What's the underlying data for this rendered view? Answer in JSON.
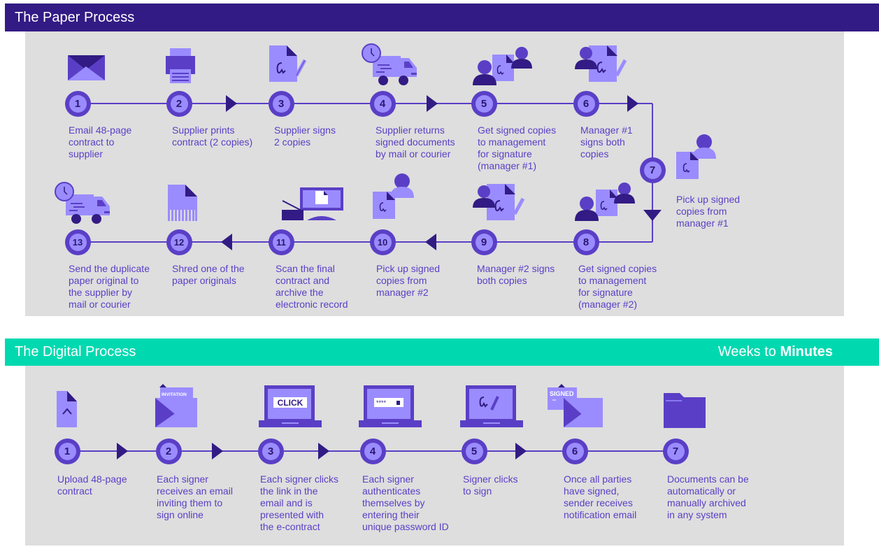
{
  "colors": {
    "paper_header": "#321b84",
    "digital_header": "#00d9b0",
    "panel": "#dedede",
    "accent": "#5a3fc6",
    "accent_light": "#9a8cff",
    "accent_dark": "#321b84"
  },
  "paper": {
    "title": "The Paper Process",
    "steps": [
      {
        "num": "1",
        "icon": "envelope-icon",
        "text": "Email 48-page\ncontract to\nsupplier"
      },
      {
        "num": "2",
        "icon": "printer-icon",
        "text": "Supplier prints\ncontract (2 copies)"
      },
      {
        "num": "3",
        "icon": "signed-document-pen-icon",
        "text": "Supplier signs\n2 copies"
      },
      {
        "num": "4",
        "icon": "delivery-truck-clock-icon",
        "text": "Supplier returns\nsigned documents\nby mail or courier"
      },
      {
        "num": "5",
        "icon": "people-document-icon",
        "text": "Get signed copies\nto management\nfor signature\n(manager #1)"
      },
      {
        "num": "6",
        "icon": "person-signing-document-icon",
        "text": "Manager #1\nsigns both\ncopies"
      },
      {
        "num": "7",
        "icon": "document-person-icon",
        "text": "Pick up signed\ncopies from\nmanager #1"
      },
      {
        "num": "8",
        "icon": "people-document-icon",
        "text": "Get signed copies\nto management\nfor signature\n(manager #2)"
      },
      {
        "num": "9",
        "icon": "person-signing-document-icon",
        "text": "Manager #2 signs\nboth copies"
      },
      {
        "num": "10",
        "icon": "document-person-icon",
        "text": "Pick up signed\ncopies from\nmanager #2"
      },
      {
        "num": "11",
        "icon": "scanner-computer-icon",
        "text": "Scan the final\ncontract and\narchive the\nelectronic record"
      },
      {
        "num": "12",
        "icon": "shredded-document-icon",
        "text": "Shred one of the\npaper originals"
      },
      {
        "num": "13",
        "icon": "delivery-truck-clock-icon",
        "text": "Send the duplicate\npaper original to\nthe supplier by\nmail or courier"
      }
    ]
  },
  "digital": {
    "title": "The Digital Process",
    "tagline_prefix": "Weeks to ",
    "tagline_bold": "Minutes",
    "steps": [
      {
        "num": "1",
        "icon": "upload-document-icon",
        "text": "Upload 48-page\ncontract"
      },
      {
        "num": "2",
        "icon": "invitation-envelope-icon",
        "icon_text": "INVITATION",
        "text": "Each signer\nreceives an email\ninviting them to\nsign online"
      },
      {
        "num": "3",
        "icon": "laptop-click-icon",
        "icon_text": "CLICK",
        "text": "Each signer clicks\nthe link in the\nemail and is\npresented with\nthe e-contract"
      },
      {
        "num": "4",
        "icon": "laptop-password-icon",
        "icon_text": "****",
        "text": "Each signer\nauthenticates\nthemselves by\nentering their\nunique password ID"
      },
      {
        "num": "5",
        "icon": "laptop-signature-icon",
        "text": "Signer clicks\nto sign"
      },
      {
        "num": "6",
        "icon": "signed-envelope-icon",
        "icon_text": "SIGNED",
        "text": "Once all parties\nhave signed,\nsender receives\nnotification email"
      },
      {
        "num": "7",
        "icon": "folder-icon",
        "text": "Documents can be\nautomatically or\nmanually archived\nin any system"
      }
    ]
  }
}
